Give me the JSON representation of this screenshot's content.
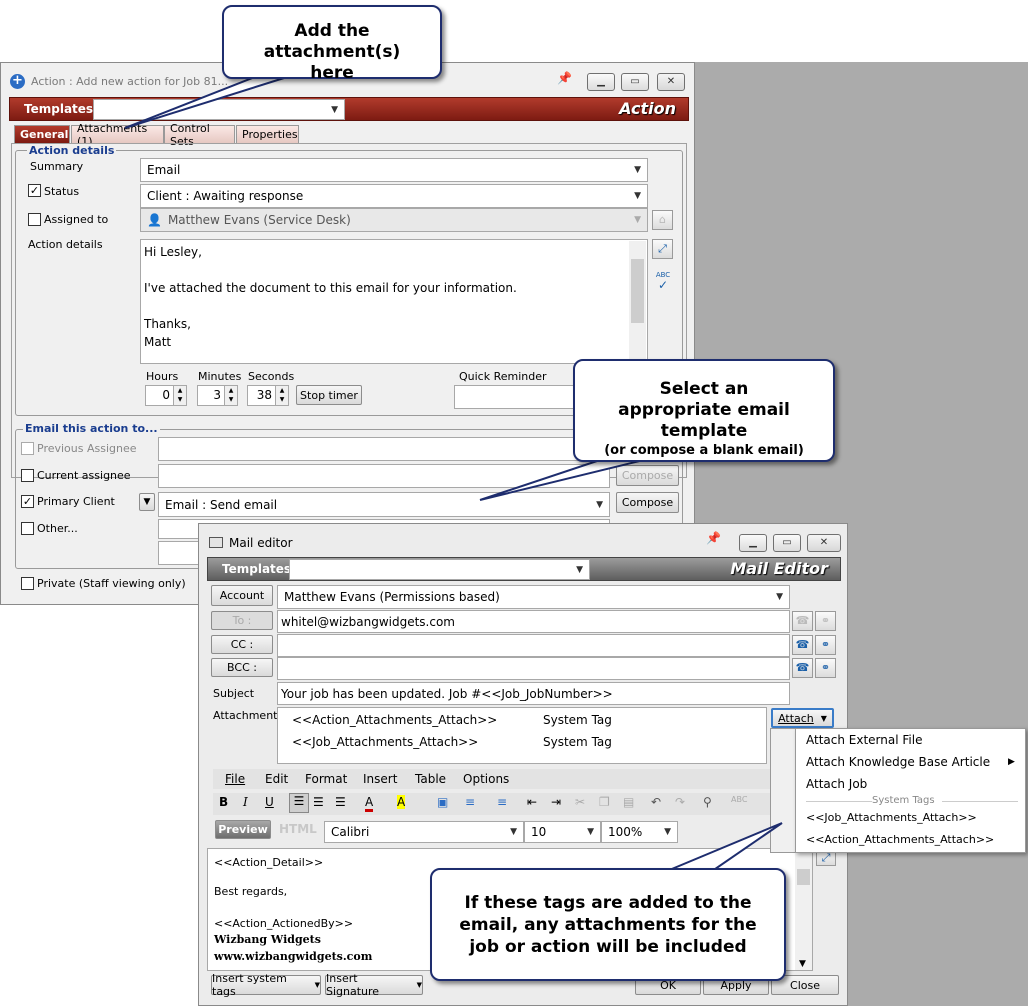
{
  "callouts": {
    "top": "Add the attachment(s) here",
    "template": {
      "line1": "Select an appropriate email template",
      "line2": "(or compose a blank email)"
    },
    "tags": "If these tags are added to the email, any attachments for the job or action will be included"
  },
  "action_window": {
    "title": "Action : Add new action for Job 81...",
    "templates_label": "Templates",
    "templates_value": "",
    "bar_title": "Action",
    "tabs": [
      "General",
      "Attachments (1)",
      "Control Sets",
      "Properties"
    ],
    "section_title": "Action details",
    "summary_label": "Summary",
    "summary_value": "Email",
    "status_label": "Status",
    "status_checked": true,
    "status_value": "Client : Awaiting response",
    "assigned_label": "Assigned to",
    "assigned_value": "Matthew Evans (Service Desk)",
    "details_label": "Action details",
    "details_lines": [
      "Hi Lesley,",
      "",
      "I've attached the document to this email for your information.",
      "",
      "Thanks,",
      "Matt"
    ],
    "hours_label": "Hours",
    "hours_value": "0",
    "minutes_label": "Minutes",
    "minutes_value": "3",
    "seconds_label": "Seconds",
    "seconds_value": "38",
    "stop_timer": "Stop timer",
    "quick_reminder_label": "Quick Reminder",
    "email_section_title": "Email this action to...",
    "prev_assignee": "Previous Assignee",
    "current_assignee": "Current assignee",
    "primary_client": "Primary Client",
    "primary_client_value": "Email : Send email",
    "other": "Other...",
    "compose": "Compose",
    "private": "Private (Staff viewing only)"
  },
  "mail_window": {
    "title": "Mail editor",
    "templates_label": "Templates",
    "bar_title": "Mail Editor",
    "account_btn": "Account",
    "account_value": "Matthew Evans   (Permissions based)",
    "to_btn": "To :",
    "to_value": "whitel@wizbangwidgets.com",
    "cc_btn": "CC :",
    "bcc_btn": "BCC :",
    "subject_label": "Subject",
    "subject_value": "Your job has been updated.  Job #<<Job_JobNumber>>",
    "attachments_label": "Attachments",
    "attachments": [
      {
        "name": "<<Action_Attachments_Attach>>",
        "type": "System Tag"
      },
      {
        "name": "<<Job_Attachments_Attach>>",
        "type": "System Tag"
      }
    ],
    "attach_btn": "Attach",
    "menu": [
      "File",
      "Edit",
      "Format",
      "Insert",
      "Table",
      "Options"
    ],
    "preview_btn": "Preview",
    "html_btn": "HTML",
    "font_value": "Calibri",
    "size_value": "10",
    "zoom_value": "100%",
    "body_lines": [
      "<<Action_Detail>>",
      "",
      "Best regards,",
      "",
      "<<Action_ActionedBy>>"
    ],
    "company": "Wizbang Widgets",
    "website": "www.wizbangwidgets.com",
    "insert_tags": "Insert system tags",
    "insert_sig": "Insert Signature",
    "ok": "OK",
    "apply": "Apply",
    "close": "Close"
  },
  "attach_menu": {
    "items": [
      "Attach External File",
      "Attach Knowledge Base Article",
      "Attach Job"
    ],
    "section": "System Tags",
    "tags": [
      "<<Job_Attachments_Attach>>",
      "<<Action_Attachments_Attach>>"
    ]
  }
}
